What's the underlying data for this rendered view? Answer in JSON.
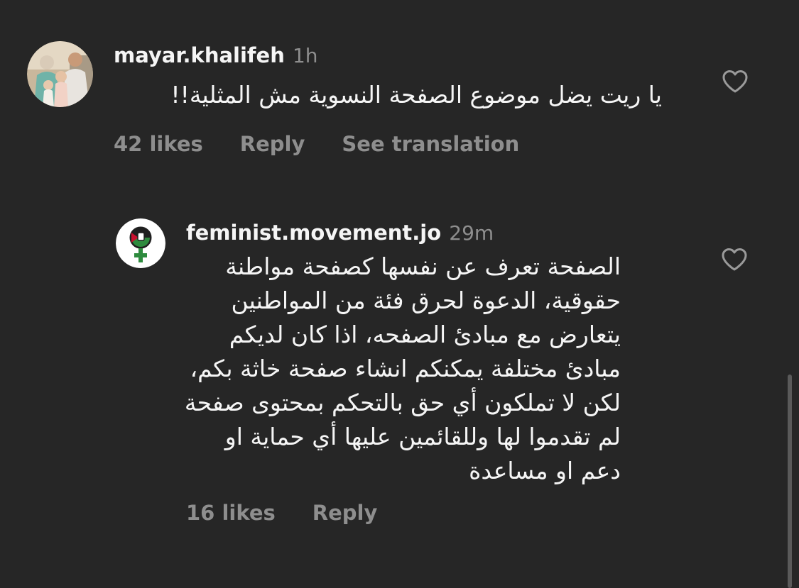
{
  "comments": [
    {
      "username": "mayar.khalifeh",
      "time": "1h",
      "text_lines": [
        "يا ريت يضل موضوع الصفحة النسوية مش المثلية!!"
      ],
      "likes": "42 likes",
      "reply_label": "Reply",
      "translate_label": "See translation"
    },
    {
      "username": "feminist.movement.jo",
      "time": "29m",
      "text_lines": [
        "الصفحة تعرف عن نفسها كصفحة مواطنة",
        "حقوقية، الدعوة لحرق فئة من المواطنين",
        "يتعارض مع مبادئ الصفحه، اذا كان لديكم",
        "مبادئ مختلفة يمكنكم انشاء صفحة خاثة بكم،",
        "لكن لا تملكون أي حق بالتحكم بمحتوى صفحة",
        "لم تقدموا لها وللقائمين عليها أي حماية او",
        "دعم او مساعدة"
      ],
      "likes": "16 likes",
      "reply_label": "Reply"
    }
  ],
  "icons": {
    "like": "heart-outline-icon"
  },
  "colors": {
    "background": "#262626",
    "primary_text": "#f5f5f5",
    "secondary_text": "#8e8e8e"
  }
}
